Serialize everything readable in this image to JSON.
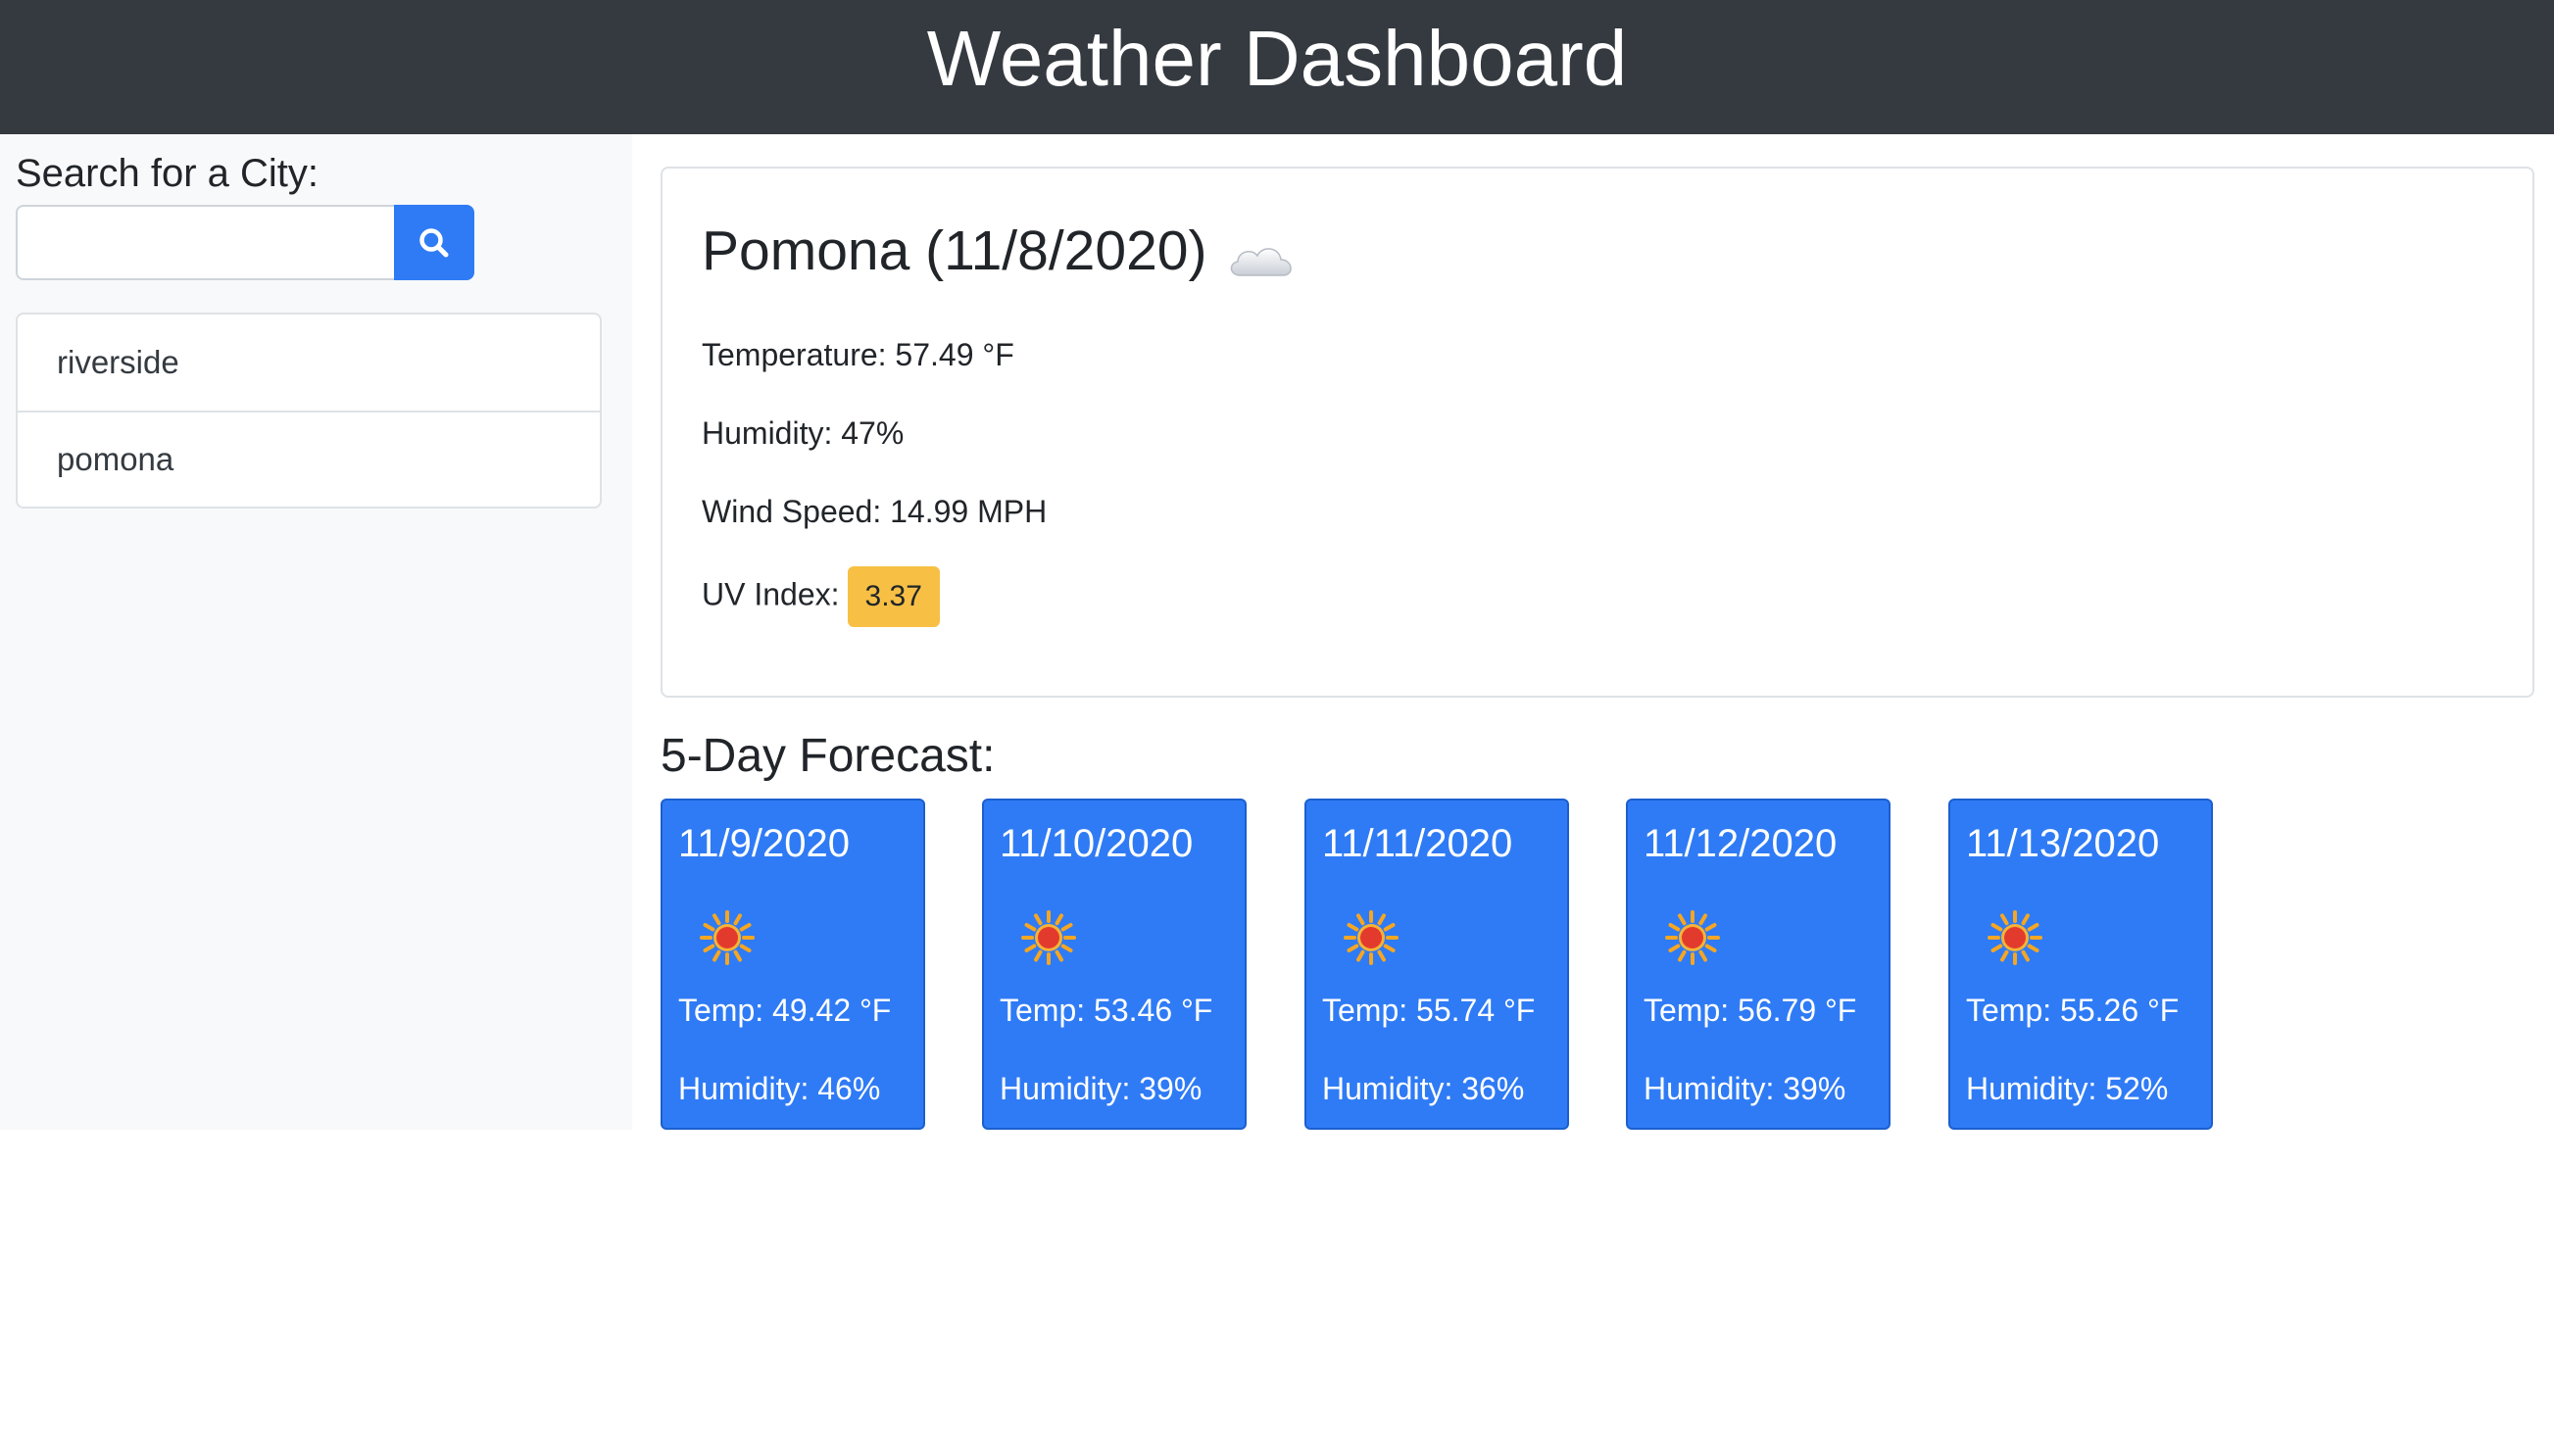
{
  "header": {
    "title": "Weather Dashboard"
  },
  "sidebar": {
    "search_label": "Search for a City:",
    "search_value": "",
    "search_placeholder": "",
    "history": [
      {
        "label": "riverside"
      },
      {
        "label": "pomona"
      }
    ]
  },
  "current": {
    "title": "Pomona (11/8/2020)",
    "icon": "cloud-icon",
    "temperature": "Temperature: 57.49 °F",
    "humidity": "Humidity: 47%",
    "wind": "Wind Speed: 14.99 MPH",
    "uv_label": "UV Index:",
    "uv_value": "3.37",
    "uv_color": "#f7c045"
  },
  "forecast": {
    "title": "5-Day Forecast:",
    "days": [
      {
        "date": "11/9/2020",
        "icon": "sun-icon",
        "temp": "Temp: 49.42 °F",
        "humidity": "Humidity: 46%"
      },
      {
        "date": "11/10/2020",
        "icon": "sun-icon",
        "temp": "Temp: 53.46 °F",
        "humidity": "Humidity: 39%"
      },
      {
        "date": "11/11/2020",
        "icon": "sun-icon",
        "temp": "Temp: 55.74 °F",
        "humidity": "Humidity: 36%"
      },
      {
        "date": "11/12/2020",
        "icon": "sun-icon",
        "temp": "Temp: 56.79 °F",
        "humidity": "Humidity: 39%"
      },
      {
        "date": "11/13/2020",
        "icon": "sun-icon",
        "temp": "Temp: 55.26 °F",
        "humidity": "Humidity: 52%"
      }
    ]
  },
  "colors": {
    "navbar": "#343a40",
    "sidebar": "#f8f9fa",
    "primary": "#2f7bf5",
    "uv_moderate": "#f7c045"
  }
}
